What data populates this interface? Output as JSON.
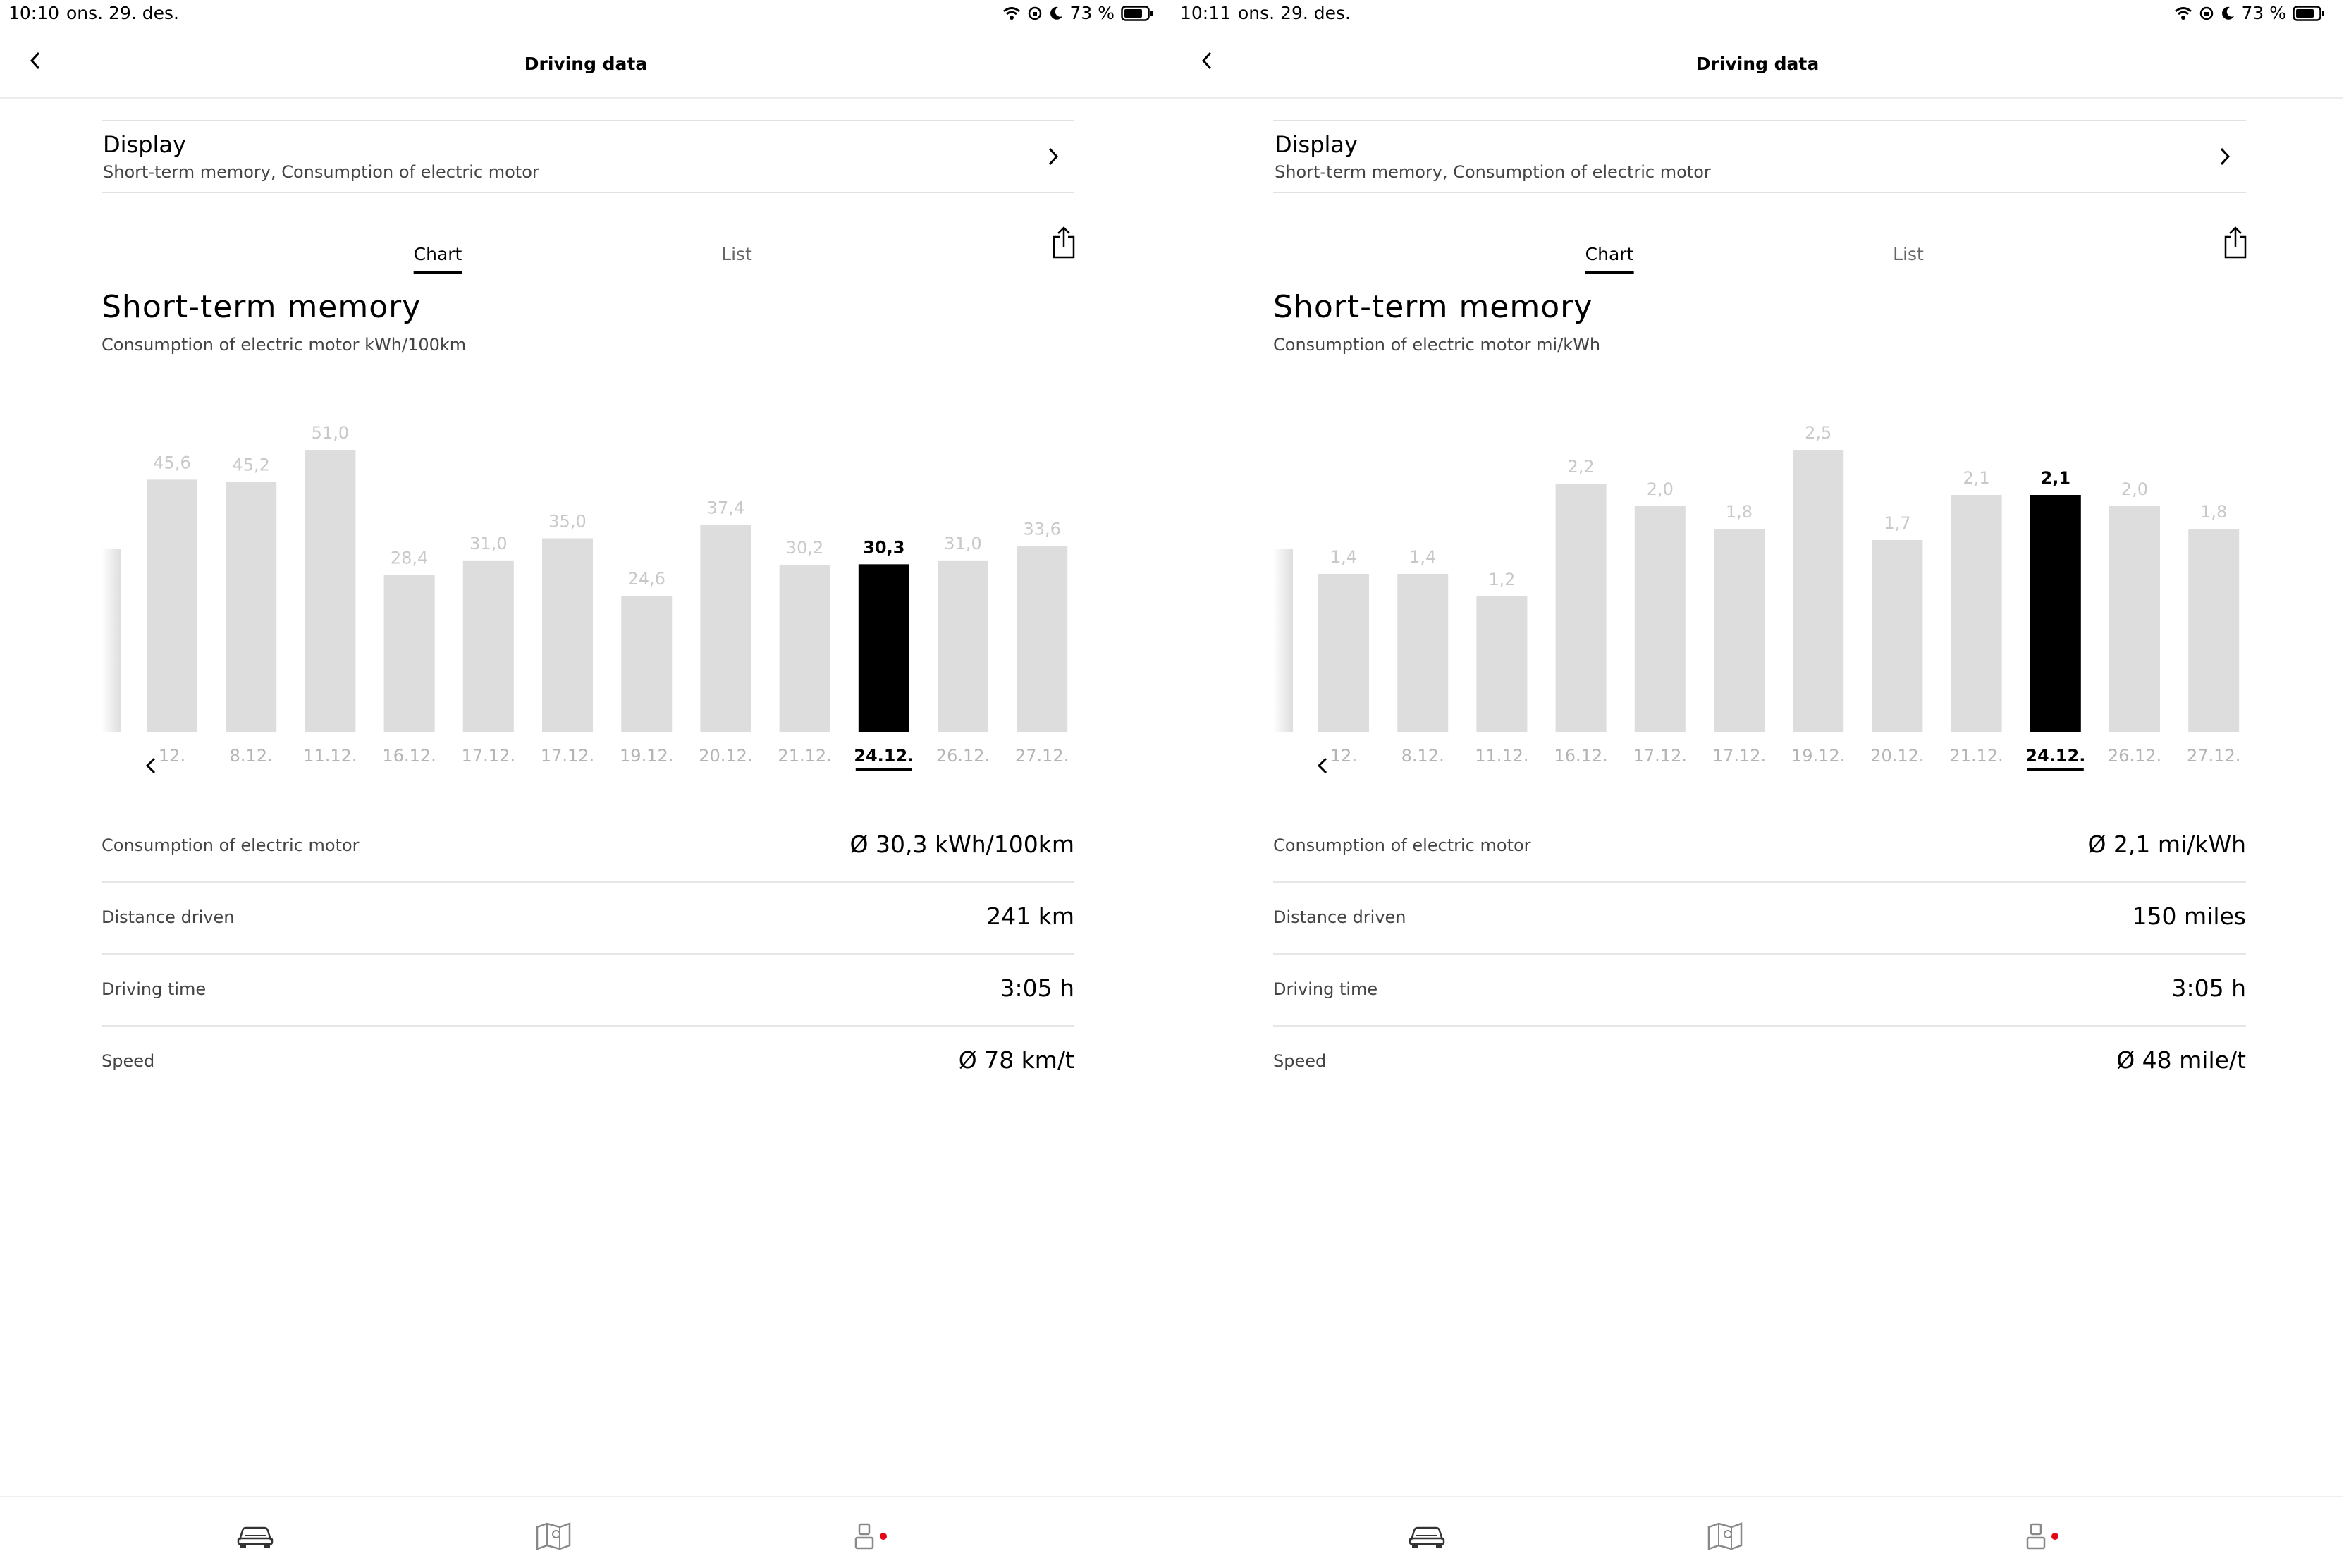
{
  "screens": [
    {
      "status": {
        "time": "10:10",
        "date": "ons. 29. des.",
        "battery": "73 %"
      },
      "nav": {
        "title": "Driving data"
      },
      "display": {
        "label": "Display",
        "sub": "Short-term memory, Consumption of electric motor"
      },
      "tabs": [
        {
          "label": "Chart",
          "active": true
        },
        {
          "label": "List",
          "active": false
        }
      ],
      "heading": "Short-term memory",
      "subheading": "Consumption of electric motor kWh/100km",
      "stats": [
        {
          "label": "Consumption of electric motor",
          "value": "Ø 30,3 kWh/100km"
        },
        {
          "label": "Distance driven",
          "value": "241 km"
        },
        {
          "label": "Driving time",
          "value": "3:05 h"
        },
        {
          "label": "Speed",
          "value": "Ø 78 km/t"
        }
      ],
      "chart_data": {
        "type": "bar",
        "categories": [
          "12.",
          "8.12.",
          "11.12.",
          "16.12.",
          "17.12.",
          "17.12.",
          "19.12.",
          "20.12.",
          "21.12.",
          "24.12.",
          "26.12.",
          "27.12."
        ],
        "values": [
          45.6,
          45.2,
          51.0,
          28.4,
          31.0,
          35.0,
          24.6,
          37.4,
          30.2,
          30.3,
          31.0,
          33.6
        ],
        "labels": [
          "45,6",
          "45,2",
          "51,0",
          "28,4",
          "31,0",
          "35,0",
          "24,6",
          "37,4",
          "30,2",
          "30,3",
          "31,0",
          "33,6"
        ],
        "selected_index": 9,
        "colors": {
          "bar": "#dddddd",
          "selected": "#000000",
          "label": "#c8c8c8",
          "tick": "#b4b4b4"
        }
      }
    },
    {
      "status": {
        "time": "10:11",
        "date": "ons. 29. des.",
        "battery": "73 %"
      },
      "nav": {
        "title": "Driving data"
      },
      "display": {
        "label": "Display",
        "sub": "Short-term memory, Consumption of electric motor"
      },
      "tabs": [
        {
          "label": "Chart",
          "active": true
        },
        {
          "label": "List",
          "active": false
        }
      ],
      "heading": "Short-term memory",
      "subheading": "Consumption of electric motor mi/kWh",
      "stats": [
        {
          "label": "Consumption of electric motor",
          "value": "Ø 2,1 mi/kWh"
        },
        {
          "label": "Distance driven",
          "value": "150 miles"
        },
        {
          "label": "Driving time",
          "value": "3:05 h"
        },
        {
          "label": "Speed",
          "value": "Ø 48 mile/t"
        }
      ],
      "chart_data": {
        "type": "bar",
        "categories": [
          "12.",
          "8.12.",
          "11.12.",
          "16.12.",
          "17.12.",
          "17.12.",
          "19.12.",
          "20.12.",
          "21.12.",
          "24.12.",
          "26.12.",
          "27.12."
        ],
        "values": [
          1.4,
          1.4,
          1.2,
          2.2,
          2.0,
          1.8,
          2.5,
          1.7,
          2.1,
          2.1,
          2.0,
          1.8
        ],
        "labels": [
          "1,4",
          "1,4",
          "1,2",
          "2,2",
          "2,0",
          "1,8",
          "2,5",
          "1,7",
          "2,1",
          "2,1",
          "2,0",
          "1,8"
        ],
        "selected_index": 9,
        "colors": {
          "bar": "#dddddd",
          "selected": "#000000",
          "label": "#c8c8c8",
          "tick": "#b4b4b4"
        }
      }
    }
  ],
  "icons": {
    "back": "chevron-left-icon",
    "forward": "chevron-right-icon",
    "share": "share-icon",
    "car": "car-icon",
    "map": "map-icon",
    "profile": "profile-icon"
  },
  "accent": {
    "notification_dot": "#e30613"
  }
}
